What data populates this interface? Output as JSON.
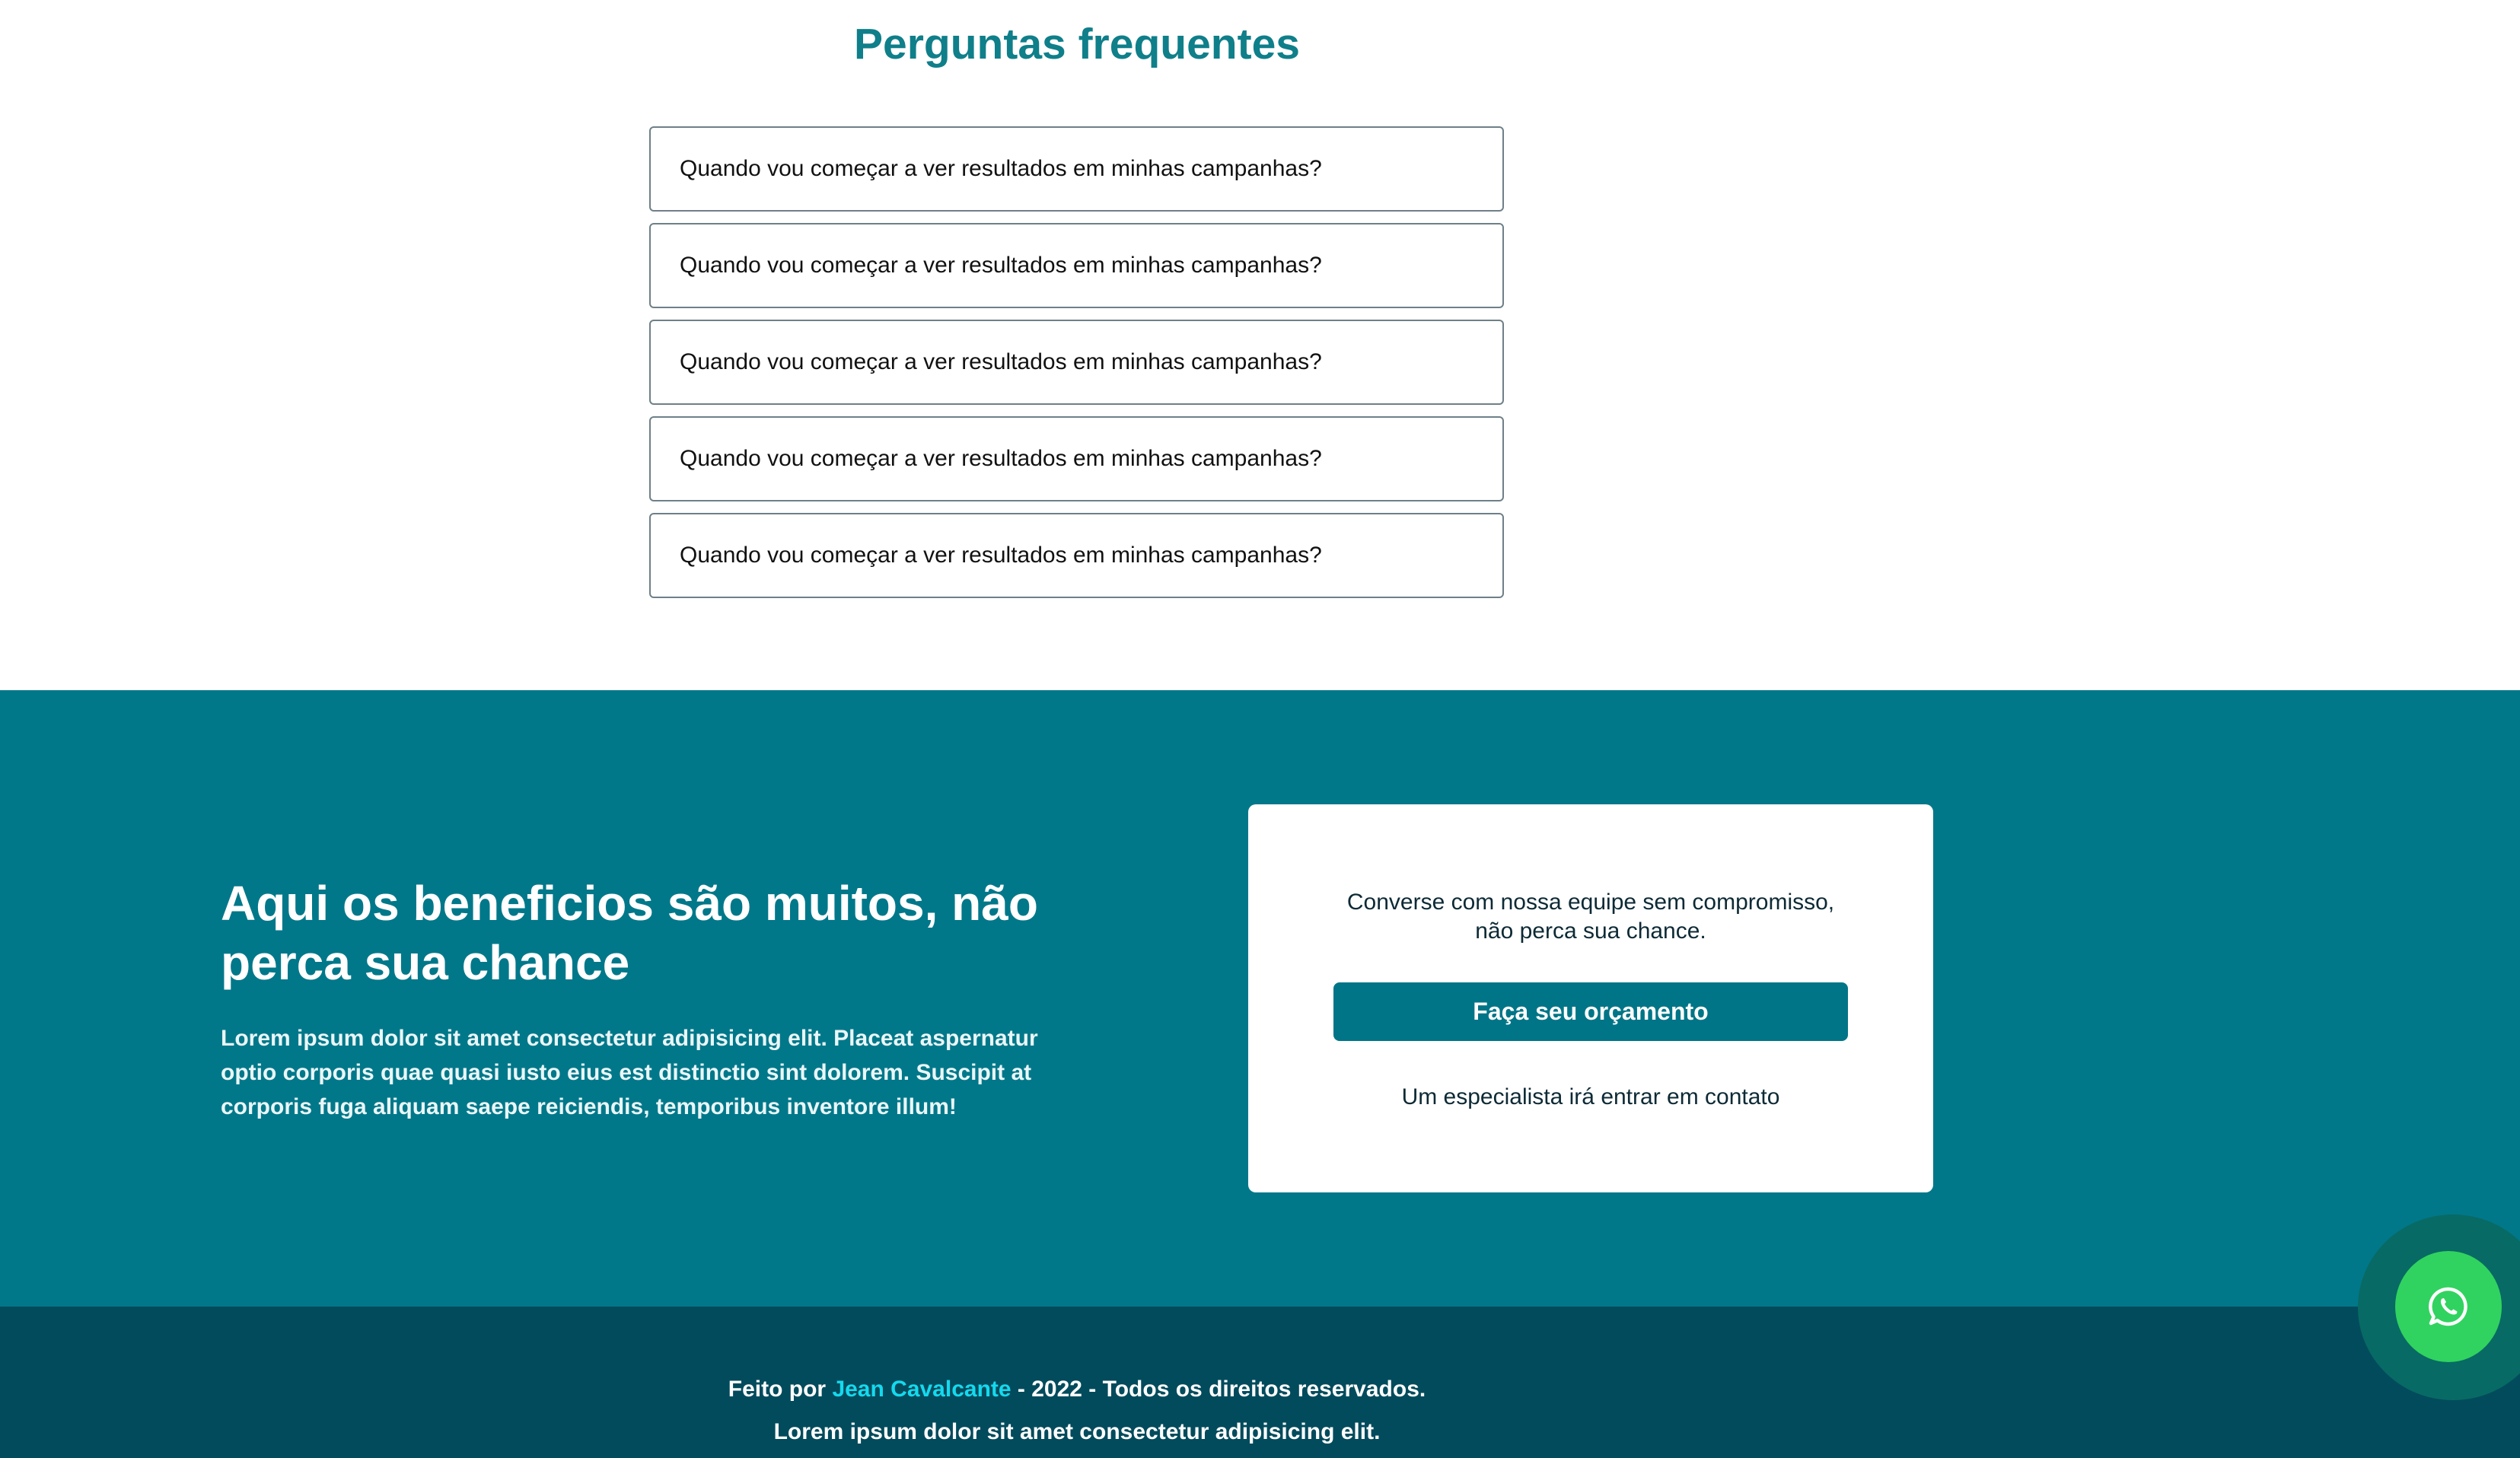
{
  "faq": {
    "title": "Perguntas frequentes",
    "items": [
      {
        "question": "Quando vou começar a ver resultados em minhas campanhas?"
      },
      {
        "question": "Quando vou começar a ver resultados em minhas campanhas?"
      },
      {
        "question": "Quando vou começar a ver resultados em minhas campanhas?"
      },
      {
        "question": "Quando vou começar a ver resultados em minhas campanhas?"
      },
      {
        "question": "Quando vou começar a ver resultados em minhas campanhas?"
      }
    ]
  },
  "cta": {
    "heading": "Aqui os beneficios são muitos, não perca sua chance",
    "body": "Lorem ipsum dolor sit amet consectetur adipisicing elit. Placeat aspernatur optio corporis quae quasi iusto eius est distinctio sint dolorem. Suscipit at corporis fuga aliquam saepe reiciendis, temporibus inventore illum!",
    "card": {
      "text_line1": "Converse com nossa equipe sem compromisso,",
      "text_line2": "não perca sua chance.",
      "button_label": "Faça seu orçamento",
      "note": "Um especialista irá entrar em contato"
    }
  },
  "footer": {
    "made_by_prefix": "Feito por ",
    "author": "Jean Cavalcante",
    "made_by_suffix": " - 2022 - Todos os direitos reservados.",
    "tagline": "Lorem ipsum dolor sit amet consectetur adipisicing elit."
  },
  "whatsapp": {
    "icon": "whatsapp-icon"
  },
  "colors": {
    "brand_teal": "#00788a",
    "footer_dark": "#024b5c",
    "title_teal": "#0f7f8a",
    "link_cyan": "#15d9ee",
    "whatsapp_green": "#30d35f"
  }
}
